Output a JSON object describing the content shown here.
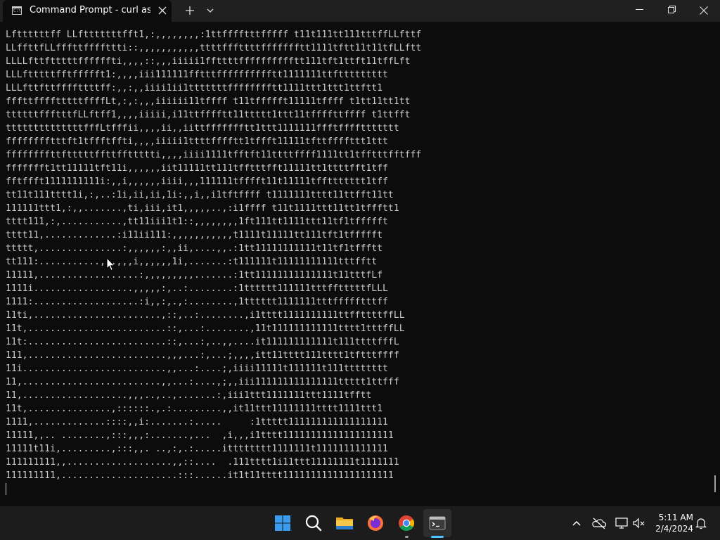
{
  "window": {
    "tab_title": "Command Prompt - curl  ascii",
    "icons": {
      "tab": "command-prompt-icon",
      "close_tab": "close-icon",
      "new_tab": "plus-icon",
      "dropdown": "chevron-down-icon",
      "minimize": "minimize-icon",
      "maximize": "restore-icon",
      "close": "close-icon"
    }
  },
  "terminal": {
    "foreground": "#cccccc",
    "background": "#0c0c0c",
    "lines": [
      "Lfttttttff LLftttttttfft1,:,,,,,,,,:1ttfffftttfffff t11t111tt111tttffLLfttf",
      "LLffttfLLfffttffffttti::,,,,,,,,,,,ttttfffttttffffffftt1111tftt11t11tfLLftt",
      "LLLLfttftttttffffffti,,,,::,,,iiiii1ffttttfffffffffftt111tft1ttft11tffLft",
      "LLLftttttfftffffft1:,,,,iii111111fftttfffffffffftt1111111ttfttttttttt",
      "LLLfttfttffffttttff:,,:,,iiii1ii1tttttttfffffffftt1111ttt1ttt1ttftt1",
      "fffttfffftttttffffLt,:,:,,,iiiiii11tffff t11tffffft11111tffff t1tt11tt1tt",
      "ttttttffftttfLLftff1,,,,iiiii,i11ttfffftt11ttttt1ttt11tffffttffff t1ttfft",
      "ttttttttttttttfffLtfffii,,,,ii,,iittffffffftt1ttt1111111ffftffffttttttt",
      "fffffffftttft1tffftffti,,,,iiiii1ttttfffftt1tffft11111tfttffffttt1ttt",
      "ffffffffttftttttffttffttttti,,,,iiii1111tfftft11ttttffff1111tt1tfftttfftfff",
      "ffffffft1tt11111tft11i,,,,,,iit11111tt111tfftttfft11111tt1ttttfft1tff",
      "fftffft1111111111i:,,i,,,,,,iiii,,,111111tfffft11t11111tffttttttt1tff",
      "tt11t111tttt1i,:,..:1i,ii,ii,1i:,,i,,i1tftffff t1111111tttt11ttfft11tt",
      "111111ttt1,:,,.......,ti,iii,it1,,,,,..,:i1ffff t11t1111ttt11tt1tffftt1",
      "tttt111,:,...........,tt11iii1t1::,,,,,,,,1ft111tt1111ttt11tf1tffffft",
      "tttt11,.............:i11ii111:,,,,,,,,,,,t1111t11111tt111tft1tffffft",
      "ttttt,...............:,,,,,,:,,ii,....,,.:1tt11111111111t11tf1tffftt",
      "tt111:...........,,,,,,i,,,,,,1i,.......:t111111t11111111111tttfftt",
      "11111,..................:,,,,,,,,,.......:1tt11111111111111t11tttfLf",
      "1111i..................,,,,,:,..:........:1tttttt111111tttfftttttfLLL",
      "1111:...................:i,,:,.,:........,1tttttt1111111tttffffftttff",
      "11ti,.......................,::,..:........,i1tttt1111111111ttffttttffLL",
      "11t,.........................::,...:........,11t111111111111tttt1tttffLL",
      "11t:.........................::,...:,..,,....it111111111111t111ttttfffL",
      "111,.........................,,,...:,...;,,,,itt11tttt111tttt1tftttffff",
      "11i..........................,,...:....;,iiii11111t111111t111tttttttt",
      "11,.........................,,...:....,;,,iii111111111111111ttttt1ttfff",
      "11,...................,,,..,..,.......:,iii1ttt1111111ttt1111tfftt",
      "11t,...............,::::::.,.:.........,,it11ttt11111111tttt1111ttt1",
      "1111,.............::::,,i:.......:.....     :1ttttt111111111111111111",
      "11111,,.. ........,:::,,,:.......,...  ,i,,,i1tttt11111111111111111111",
      "11111t11i,.........,:::,,. ..,:,.:.....itttttttt1111111t1111111111111",
      "111111111,,...................,,::....  .111tttt1i11ttt11111111t1111111",
      "111111111,.....................:::......it1t11tttt11111111111111111111"
    ]
  },
  "taskbar": {
    "apps": [
      {
        "name": "start-button",
        "icon": "windows-logo-icon"
      },
      {
        "name": "search-button",
        "icon": "search-icon"
      },
      {
        "name": "file-explorer-button",
        "icon": "folder-icon"
      },
      {
        "name": "firefox-button",
        "icon": "firefox-icon"
      },
      {
        "name": "chrome-button",
        "icon": "chrome-icon"
      },
      {
        "name": "terminal-button",
        "icon": "terminal-icon"
      }
    ],
    "tray": {
      "icons": [
        "chevron-up-icon",
        "onedrive-icon",
        "network-icon",
        "volume-muted-icon",
        "notification-bell-icon"
      ]
    },
    "clock": {
      "time": "5:11 AM",
      "date": "2/4/2024"
    }
  }
}
